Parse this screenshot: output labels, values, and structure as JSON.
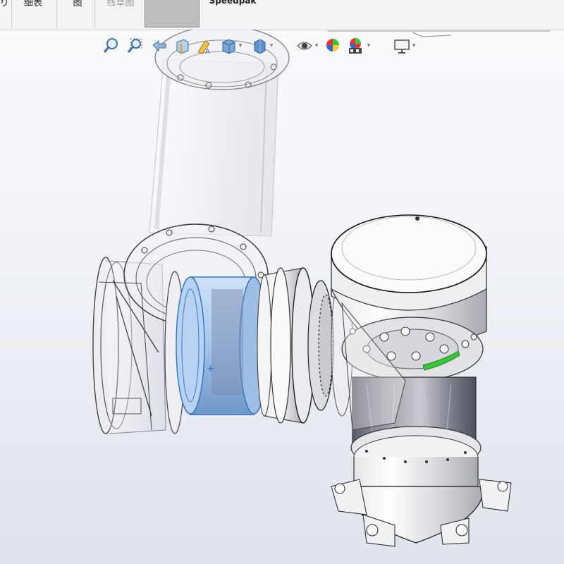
{
  "ribbon": {
    "tabs": [
      {
        "label": "り"
      },
      {
        "label": "细表"
      },
      {
        "label": "图"
      },
      {
        "label": "线草图"
      },
      {
        "label": ""
      },
      {
        "label": "Speedpak"
      }
    ],
    "active_tab_index": 4
  },
  "toolbar": {
    "icons": [
      {
        "name": "zoom-to-fit-icon"
      },
      {
        "name": "zoom-to-area-icon"
      },
      {
        "name": "previous-view-icon"
      },
      {
        "name": "section-view-icon"
      },
      {
        "name": "dynamic-annotation-icon"
      },
      {
        "name": "view-orientation-icon"
      },
      {
        "name": "display-style-icon"
      },
      {
        "name": "hide-show-items-icon"
      },
      {
        "name": "edit-appearance-icon"
      },
      {
        "name": "apply-scene-icon"
      },
      {
        "name": "view-settings-icon"
      }
    ]
  },
  "colors": {
    "selection_blue": "#5a9fe0",
    "highlight_green": "#39c43a",
    "ribbon_bg": "#f4f4f4",
    "active_tab": "#bdbdbd"
  }
}
